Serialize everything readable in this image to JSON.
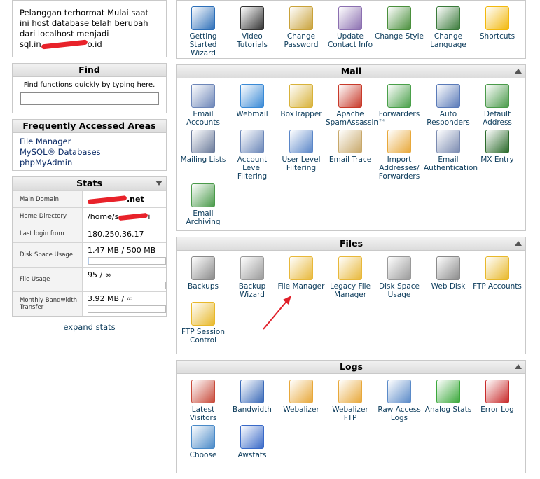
{
  "notice": {
    "text": "Pelanggan terhormat Mulai saat ini host database telah berubah dari localhost menjadi",
    "host_prefix": "sql.in",
    "host_suffix": "o.id"
  },
  "find": {
    "title": "Find",
    "hint": "Find functions quickly by typing here.",
    "value": ""
  },
  "faa": {
    "title": "Frequently Accessed Areas",
    "links": [
      "File Manager",
      "MySQL® Databases",
      "phpMyAdmin"
    ]
  },
  "stats": {
    "title": "Stats",
    "rows": [
      {
        "label": "Main Domain",
        "value": ".net"
      },
      {
        "label": "Home Directory",
        "value": "/home/s"
      },
      {
        "label": "Last login from",
        "value": "180.250.36.17"
      },
      {
        "label": "Disk Space Usage",
        "value": "1.47 MB / 500 MB",
        "progress": 0.003
      },
      {
        "label": "File Usage",
        "value": "95 / ∞",
        "progress": 0
      },
      {
        "label": "Monthly Bandwidth Transfer",
        "value": "3.92 MB / ∞",
        "progress": 0
      }
    ],
    "expand": "expand stats"
  },
  "top_items": [
    {
      "label": "Getting Started Wizard",
      "icon": "play-icon",
      "color": "#2d6fb8"
    },
    {
      "label": "Video Tutorials",
      "icon": "clapper-icon",
      "color": "#333333"
    },
    {
      "label": "Change Password",
      "icon": "lock-icon",
      "color": "#c9a23a"
    },
    {
      "label": "Update Contact Info",
      "icon": "contact-icon",
      "color": "#8b6fb0"
    },
    {
      "label": "Change Style",
      "icon": "style-icon",
      "color": "#4a8f3c"
    },
    {
      "label": "Change Language",
      "icon": "language-icon",
      "color": "#3a7a3a"
    },
    {
      "label": "Shortcuts",
      "icon": "star-icon",
      "color": "#f2b80c"
    }
  ],
  "mail": {
    "title": "Mail",
    "items": [
      {
        "label": "Email Accounts",
        "icon": "envelope-icon",
        "color": "#6d86b8"
      },
      {
        "label": "Webmail",
        "icon": "globe-mail-icon",
        "color": "#3a8ad6"
      },
      {
        "label": "BoxTrapper",
        "icon": "boxtrapper-icon",
        "color": "#d8b23a"
      },
      {
        "label": "Apache SpamAssassin™",
        "icon": "spamassassin-icon",
        "color": "#c83a2a"
      },
      {
        "label": "Forwarders",
        "icon": "forward-icon",
        "color": "#4aa04a"
      },
      {
        "label": "Auto Responders",
        "icon": "autoresponder-icon",
        "color": "#5a7ab8"
      },
      {
        "label": "Default Address",
        "icon": "default-address-icon",
        "color": "#4a9a4a"
      },
      {
        "label": "Mailing Lists",
        "icon": "mailing-list-icon",
        "color": "#6a7a9a"
      },
      {
        "label": "Account Level Filtering",
        "icon": "filter-icon",
        "color": "#6a86b8"
      },
      {
        "label": "User Level Filtering",
        "icon": "user-filter-icon",
        "color": "#5a86c8"
      },
      {
        "label": "Email Trace",
        "icon": "trace-icon",
        "color": "#c8a86a"
      },
      {
        "label": "Import Addresses/ Forwarders",
        "icon": "import-icon",
        "color": "#e8a83a"
      },
      {
        "label": "Email Authentication",
        "icon": "auth-icon",
        "color": "#7a8ab0"
      },
      {
        "label": "MX Entry",
        "icon": "mx-icon",
        "color": "#2a6a2a"
      },
      {
        "label": "Email Archiving",
        "icon": "archive-icon",
        "color": "#4a9a4a"
      }
    ]
  },
  "files": {
    "title": "Files",
    "items": [
      {
        "label": "Backups",
        "icon": "backup-drive-icon",
        "color": "#8a8a8a"
      },
      {
        "label": "Backup Wizard",
        "icon": "backup-wizard-icon",
        "color": "#9a9a9a"
      },
      {
        "label": "File Manager",
        "icon": "folder-icon",
        "color": "#e8b83a"
      },
      {
        "label": "Legacy File Manager",
        "icon": "legacy-folder-icon",
        "color": "#e8b83a"
      },
      {
        "label": "Disk Space Usage",
        "icon": "disk-icon",
        "color": "#9a9a9a"
      },
      {
        "label": "Web Disk",
        "icon": "webdisk-icon",
        "color": "#8a8a8a"
      },
      {
        "label": "FTP Accounts",
        "icon": "ftp-icon",
        "color": "#e8b82a"
      },
      {
        "label": "FTP Session Control",
        "icon": "ftp-session-icon",
        "color": "#e8b82a"
      }
    ]
  },
  "logs": {
    "title": "Logs",
    "items": [
      {
        "label": "Latest Visitors",
        "icon": "visitors-icon",
        "color": "#c84a3a"
      },
      {
        "label": "Bandwidth",
        "icon": "bandwidth-icon",
        "color": "#3a6ab8"
      },
      {
        "label": "Webalizer",
        "icon": "webalizer-icon",
        "color": "#e8a83a"
      },
      {
        "label": "Webalizer FTP",
        "icon": "webalizer-ftp-icon",
        "color": "#e8a83a"
      },
      {
        "label": "Raw Access Logs",
        "icon": "raw-log-icon",
        "color": "#5a8ac8"
      },
      {
        "label": "Analog Stats",
        "icon": "analog-icon",
        "color": "#3aa83a"
      },
      {
        "label": "Error Log",
        "icon": "error-log-icon",
        "color": "#c82a2a"
      },
      {
        "label": "Choose",
        "icon": "choose-icon",
        "color": "#4a8ac8"
      },
      {
        "label": "Awstats",
        "icon": "awstats-icon",
        "color": "#3a6ac8"
      }
    ]
  }
}
